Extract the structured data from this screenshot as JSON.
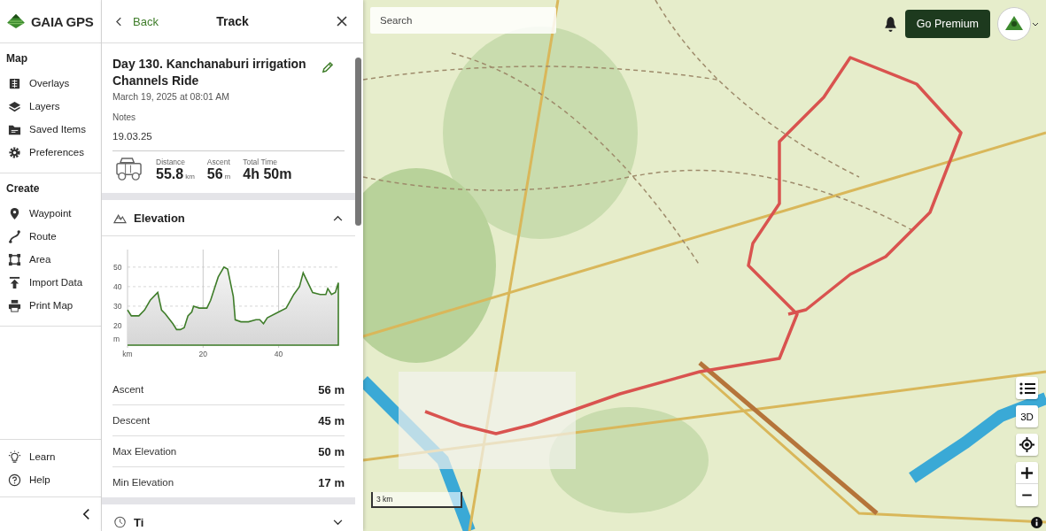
{
  "sidebar": {
    "logo": "GAIA GPS",
    "sections": [
      {
        "heading": "Map",
        "items": [
          {
            "label": "Overlays",
            "kind": "overlays"
          },
          {
            "label": "Layers",
            "kind": "layers"
          },
          {
            "label": "Saved Items",
            "kind": "saved"
          },
          {
            "label": "Preferences",
            "kind": "preferences"
          }
        ]
      },
      {
        "heading": "Create",
        "items": [
          {
            "label": "Waypoint",
            "kind": "waypoint"
          },
          {
            "label": "Route",
            "kind": "route"
          },
          {
            "label": "Area",
            "kind": "area"
          },
          {
            "label": "Import Data",
            "kind": "import"
          },
          {
            "label": "Print Map",
            "kind": "print"
          }
        ]
      }
    ],
    "footer_items": [
      {
        "label": "Learn",
        "kind": "learn"
      },
      {
        "label": "Help",
        "kind": "help"
      }
    ]
  },
  "panel": {
    "back": "Back",
    "title": "Track",
    "track": {
      "name": "Day 130. Kanchanaburi irrigation Channels Ride",
      "date": "March 19, 2025 at 08:01 AM",
      "notes_label": "Notes",
      "notes": "19.03.25",
      "stats": [
        {
          "label": "Distance",
          "value": "55.8",
          "unit": "km"
        },
        {
          "label": "Ascent",
          "value": "56",
          "unit": "m"
        },
        {
          "label": "Total Time",
          "value": "4h 50m"
        }
      ]
    },
    "sections": [
      {
        "title": "Elevation",
        "kind": "elevation",
        "expanded": true,
        "chart_data": {
          "type": "area",
          "grid": true,
          "xlim": [
            0,
            55.8
          ],
          "ylim": [
            10,
            59
          ],
          "xticks": [
            {
              "value": 0,
              "label": "km"
            },
            20,
            40
          ],
          "yticks": [
            {
              "value": 13,
              "label": "m"
            },
            20,
            30,
            40,
            50
          ],
          "x": [
            0,
            1,
            2,
            3,
            4.5,
            6,
            8,
            9,
            10,
            12,
            13,
            14,
            15,
            16,
            17,
            17.5,
            19,
            20,
            21,
            22,
            24,
            25.5,
            26.5,
            28,
            28.5,
            30,
            32,
            34,
            35,
            36,
            37,
            40,
            42,
            44,
            45.5,
            46.5,
            48,
            49,
            51,
            52.5,
            53,
            54,
            55,
            55.8
          ],
          "series": [
            {
              "color": "#3f7d2a",
              "values": [
                28,
                25,
                25,
                25,
                28,
                33,
                37,
                28,
                26,
                21,
                18,
                18,
                19,
                25,
                27,
                30,
                29,
                29,
                29,
                33,
                45,
                50,
                49,
                35,
                23,
                22,
                22,
                23,
                23,
                21,
                24,
                27,
                29,
                36,
                40,
                47,
                41,
                37,
                36,
                36,
                39,
                36,
                37,
                42
              ]
            }
          ]
        },
        "rows": [
          {
            "label": "Ascent",
            "value": "56 m"
          },
          {
            "label": "Descent",
            "value": "45 m"
          },
          {
            "label": "Max Elevation",
            "value": "50 m"
          },
          {
            "label": "Min Elevation",
            "value": "17 m"
          }
        ]
      },
      {
        "title": "Ti",
        "kind": "time",
        "expanded": false
      }
    ]
  },
  "map": {
    "search": {
      "placeholder": "Search"
    },
    "premium_button": "Go Premium",
    "controls": [
      {
        "kind": "list"
      },
      {
        "kind": "text",
        "label": "3D"
      },
      {
        "kind": "locate"
      },
      {
        "kind": "zoom-in"
      },
      {
        "kind": "zoom-out"
      }
    ],
    "scale": "3 km"
  }
}
